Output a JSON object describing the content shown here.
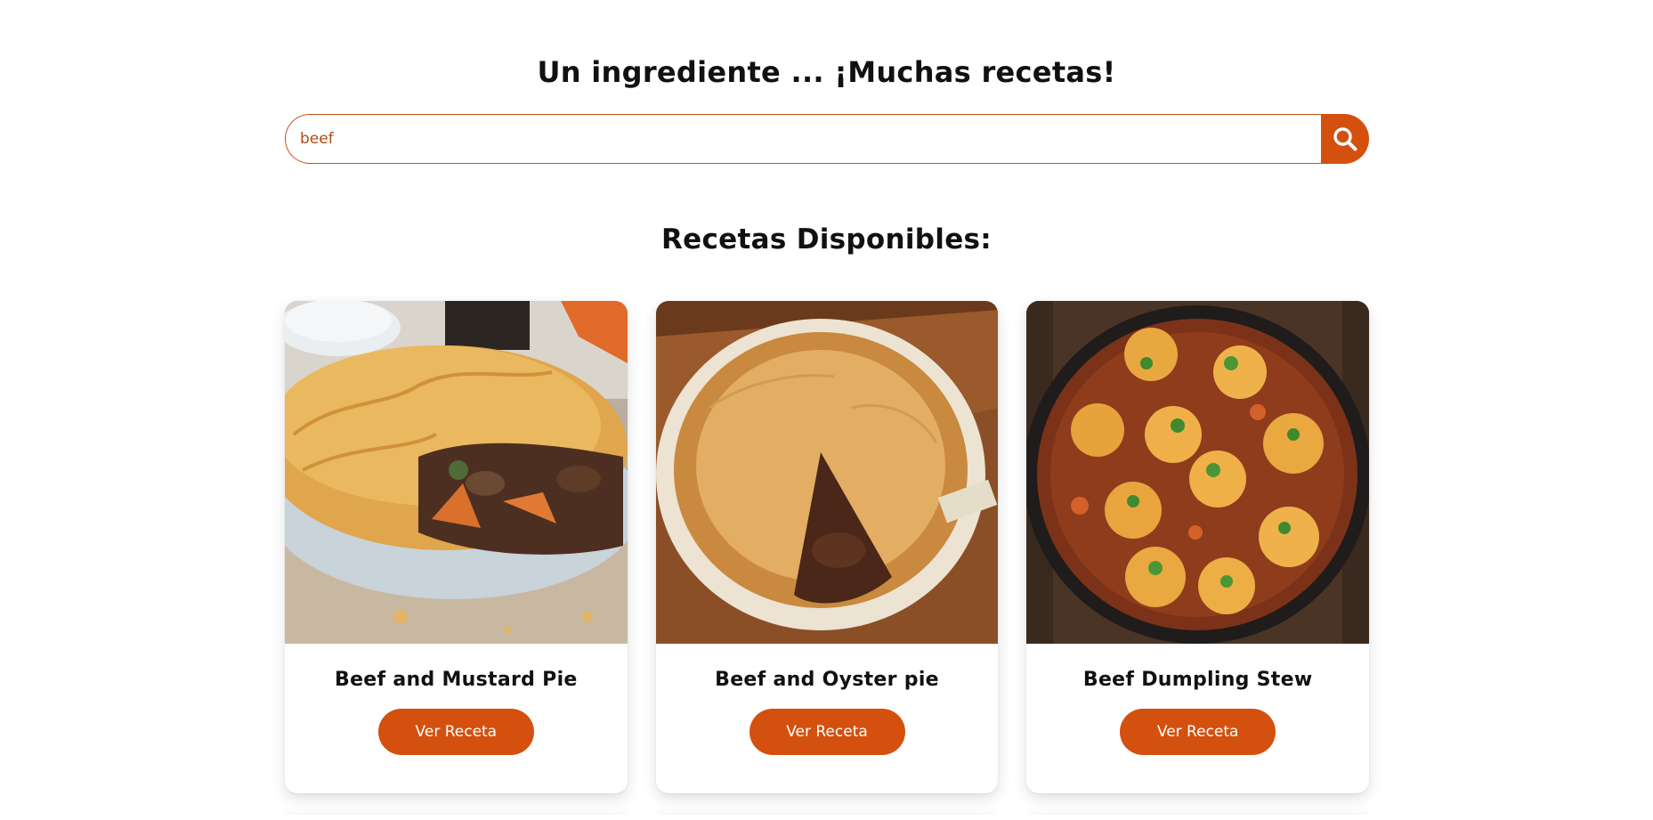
{
  "hero": {
    "title": "Un ingrediente ... ¡Muchas recetas!"
  },
  "search": {
    "value": "beef",
    "button_icon": "search-icon"
  },
  "results": {
    "title": "Recetas Disponibles:"
  },
  "recipes": [
    {
      "title": "Beef and Mustard Pie",
      "button_label": "Ver Receta",
      "image": "beef-and-mustard-pie-photo"
    },
    {
      "title": "Beef and Oyster pie",
      "button_label": "Ver Receta",
      "image": "beef-and-oyster-pie-photo"
    },
    {
      "title": "Beef Dumpling Stew",
      "button_label": "Ver Receta",
      "image": "beef-dumpling-stew-photo"
    }
  ],
  "colors": {
    "accent": "#d4500f",
    "input_border": "#c0531a"
  }
}
